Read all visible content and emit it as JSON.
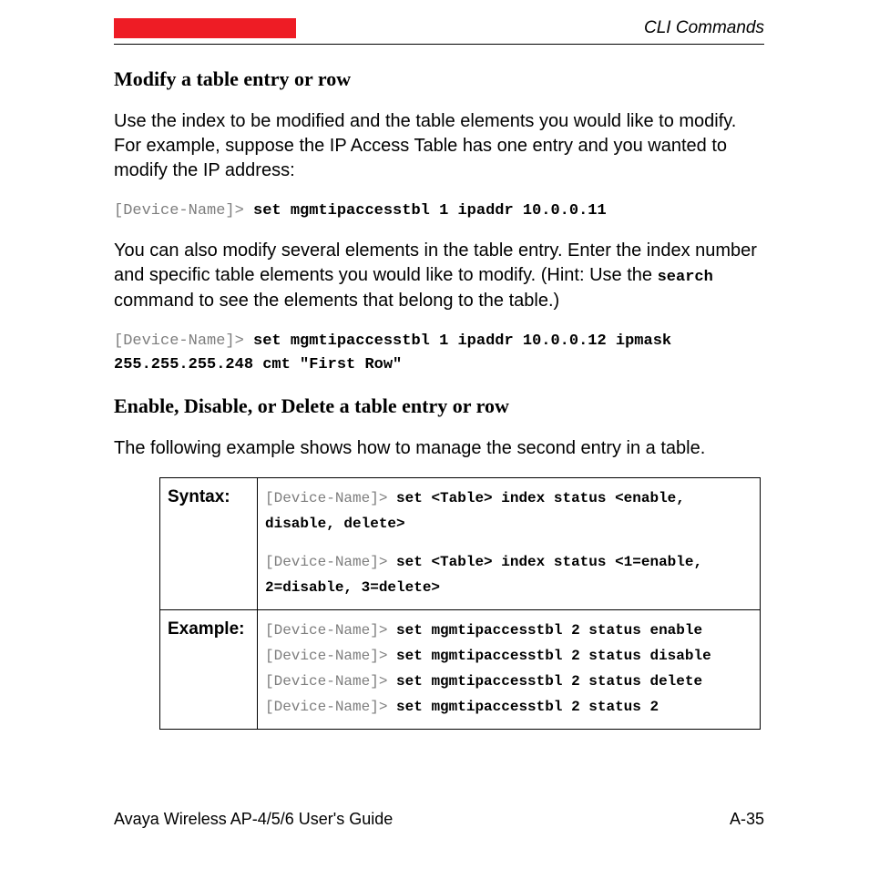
{
  "header": {
    "section_label": "CLI Commands"
  },
  "sections": {
    "modify_title": "Modify a table entry or row",
    "modify_intro": "Use the index to be modified and the table elements you would like to modify. For example, suppose the IP Access Table has one entry and you wanted to modify the IP address:",
    "modify_cmd1_prompt": "[Device-Name]> ",
    "modify_cmd1_command": "set mgmtipaccesstbl 1 ipaddr 10.0.0.11",
    "modify_p2_part1": "You can also modify several elements in the table entry. Enter the index number and specific table elements you would like to modify. (Hint: Use the ",
    "modify_p2_inline": "search",
    "modify_p2_part2": " command to see the elements that belong to the table.)",
    "modify_cmd2_prompt": "[Device-Name]> ",
    "modify_cmd2_command": "set mgmtipaccesstbl 1 ipaddr 10.0.0.12 ipmask 255.255.255.248 cmt \"First Row\"",
    "enable_title": "Enable, Disable, or Delete a table entry or row",
    "enable_intro": "The following example shows how to manage the second entry in a table."
  },
  "table": {
    "syntax_label": "Syntax:",
    "example_label": "Example:",
    "syntax_block1_prompt": "[Device-Name]> ",
    "syntax_block1_cmd": "set <Table> index status <enable, disable, delete>",
    "syntax_block2_prompt": "[Device-Name]> ",
    "syntax_block2_cmd": "set <Table> index status <1=enable, 2=disable, 3=delete>",
    "ex1_prompt": "[Device-Name]> ",
    "ex1_cmd": "set mgmtipaccesstbl 2 status enable",
    "ex2_prompt": "[Device-Name]> ",
    "ex2_cmd": "set mgmtipaccesstbl 2 status disable",
    "ex3_prompt": "[Device-Name]> ",
    "ex3_cmd": "set mgmtipaccesstbl 2 status delete",
    "ex4_prompt": "[Device-Name]> ",
    "ex4_cmd": "set mgmtipaccesstbl 2 status 2"
  },
  "footer": {
    "left": "Avaya Wireless AP-4/5/6 User's Guide",
    "right": "A-35"
  }
}
